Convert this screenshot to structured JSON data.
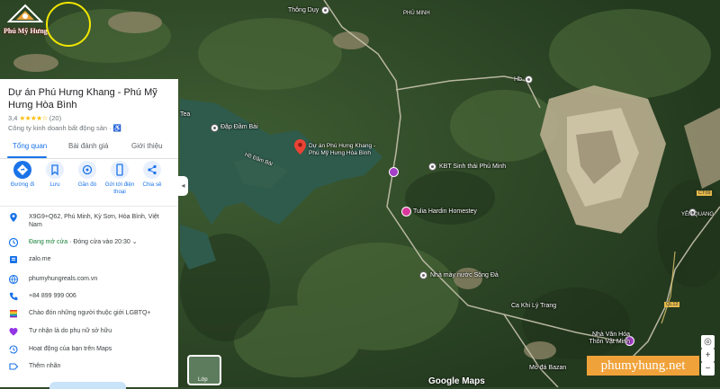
{
  "place": {
    "title": "Dự án Phú Hưng Khang - Phú Mỹ Hưng Hòa Bình",
    "rating_value": "3,4",
    "stars": "★★★★☆",
    "review_count": "(20)",
    "category": "Công ty kinh doanh bất động sản · ♿"
  },
  "tabs": [
    {
      "label": "Tổng quan"
    },
    {
      "label": "Bài đánh giá"
    },
    {
      "label": "Giới thiệu"
    }
  ],
  "actions": [
    {
      "label": "Đường đi",
      "icon": "directions-icon"
    },
    {
      "label": "Lưu",
      "icon": "bookmark-icon"
    },
    {
      "label": "Gần đó",
      "icon": "nearby-icon"
    },
    {
      "label": "Gửi tới điện thoại",
      "icon": "phone-icon"
    },
    {
      "label": "Chia sẻ",
      "icon": "share-icon"
    }
  ],
  "info": {
    "address": "X9G9+Q62, Phú Minh, Kỳ Sơn, Hòa Bình, Việt Nam",
    "hours_status": "Đang mở cửa",
    "hours_detail": " · Đóng cửa vào 20:30",
    "hours_chevron": "⌄",
    "menu_site": "zalo.me",
    "website": "phumyhungreals.com.vn",
    "phone": "+84 899 999 006",
    "lgbtq": "Chào đón những người thuộc giới LGBTQ+",
    "women_owned": "Tự nhận là do phụ nữ sở hữu",
    "activity": "Hoạt động của bạn trên Maps",
    "add_label": "Thêm nhãn"
  },
  "map_labels": {
    "thong_duy": "Thông Dụy",
    "phu_minh": "PHÚ MINH",
    "hb": "Hb",
    "tea": "Tea",
    "dap_dam_bai": "Đập Đầm Bài",
    "project_pin": "Dự án Phú Hưng Khang - Phú Mỹ Hưng Hòa Bình",
    "ho_dam_bai": "Hồ Đầm Bài",
    "kbt_sinh_thai": "KBT Sinh thái Phú Minh",
    "tulia": "Tulia Hardin Homestey",
    "nha_may_nuoc": "Nhà máy nước Sông Đà",
    "yen_quang": "YÊN QUANG",
    "ca_khi": "Ca Khi Lý Trang",
    "nha_van_hoa": "Nhà Văn Hóa Thôn Vật Minh",
    "mo_da": "Mỏ đá Bazan",
    "road_ct09": "CT09",
    "road_ql12": "QL12"
  },
  "logo": {
    "text": "Phú Mỹ Hưng"
  },
  "watermark": "phumyhung.net",
  "google": "Google Maps",
  "layer_label": "Lớp",
  "colors": {
    "accent": "#1a73e8",
    "open": "#188038",
    "watermark_bg": "#f0a23a",
    "pin_red": "#ea4335"
  }
}
